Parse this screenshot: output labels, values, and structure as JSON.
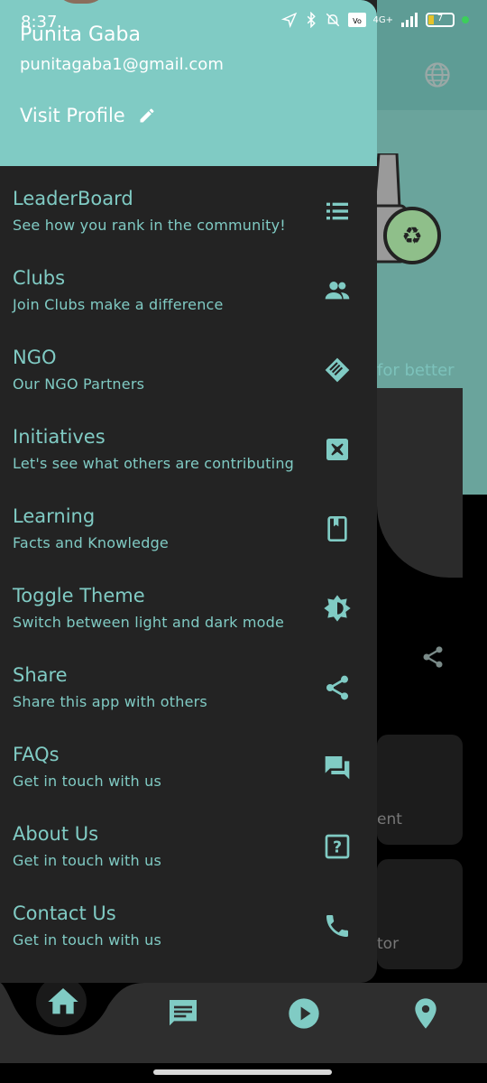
{
  "status_bar": {
    "time": "8:37",
    "network": "4G+",
    "battery": "7"
  },
  "drawer": {
    "user_name": "Punita Gaba",
    "user_email": "punitagaba1@gmail.com",
    "visit_profile": "Visit Profile",
    "items": [
      {
        "title": "LeaderBoard",
        "subtitle": "See how you rank in the community!",
        "icon": "leaderboard-list-icon"
      },
      {
        "title": "Clubs",
        "subtitle": "Join Clubs make a difference",
        "icon": "people-icon"
      },
      {
        "title": "NGO",
        "subtitle": "Our NGO Partners",
        "icon": "handshake-icon"
      },
      {
        "title": "Initiatives",
        "subtitle": "Let's see what others are contributing",
        "icon": "initiatives-icon"
      },
      {
        "title": "Learning",
        "subtitle": "Facts and Knowledge",
        "icon": "book-icon"
      },
      {
        "title": "Toggle Theme",
        "subtitle": "Switch between light and dark mode",
        "icon": "brightness-icon"
      },
      {
        "title": "Share",
        "subtitle": "Share this app with others",
        "icon": "share-icon"
      },
      {
        "title": "FAQs",
        "subtitle": "Get in touch with us",
        "icon": "forum-icon"
      },
      {
        "title": "About Us",
        "subtitle": "Get in touch with us",
        "icon": "help-box-icon"
      },
      {
        "title": "Contact Us",
        "subtitle": "Get in touch with us",
        "icon": "phone-icon"
      }
    ]
  },
  "background": {
    "partial_text": "for better",
    "card1_partial": "ent",
    "card2_partial": "tor"
  },
  "bottom_nav": [
    "home-icon",
    "chat-icon",
    "play-icon",
    "location-pin-icon"
  ],
  "colors": {
    "accent": "#80cbc4",
    "drawer_bg": "#232323",
    "nav_bg": "#2e2e2e"
  }
}
